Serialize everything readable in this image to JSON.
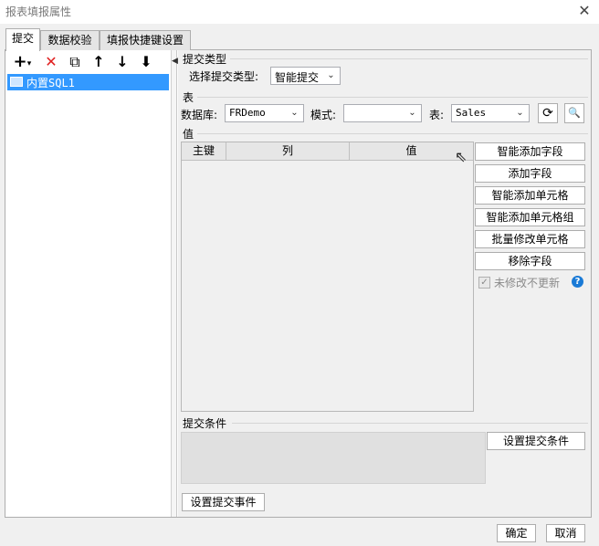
{
  "window": {
    "title": "报表填报属性",
    "close": "✕"
  },
  "tabs": [
    "提交",
    "数据校验",
    "填报快捷键设置"
  ],
  "left_toolbar": {
    "add": "+",
    "add_arrow": "▾",
    "delete": "✕",
    "copy": "⧉",
    "up": "↑",
    "down": "↓",
    "sort": "⬇"
  },
  "tree": {
    "items": [
      {
        "label": "内置SQL1"
      }
    ]
  },
  "splitter_arrow": "◀",
  "submit_type": {
    "section": "提交类型",
    "label": "选择提交类型:",
    "value": "智能提交"
  },
  "table_section": {
    "section": "表",
    "db_label": "数据库:",
    "db_value": "FRDemo",
    "mode_label": "模式:",
    "mode_value": "",
    "table_label": "表:",
    "table_value": "Sales",
    "refresh_icon": "⟳",
    "preview_icon": "🔍"
  },
  "value_section": {
    "section": "值",
    "columns": [
      "主键",
      "列",
      "值"
    ]
  },
  "side_buttons": [
    "智能添加字段",
    "添加字段",
    "智能添加单元格",
    "智能添加单元格组",
    "批量修改单元格",
    "移除字段"
  ],
  "unmodified_no_update": {
    "label": "未修改不更新",
    "checked": true,
    "help": "?"
  },
  "submit_condition": {
    "section": "提交条件",
    "button": "设置提交条件"
  },
  "submit_event_button": "设置提交事件",
  "footer": {
    "ok": "确定",
    "cancel": "取消"
  },
  "colors": {
    "selection": "#3399ff",
    "delete_icon": "#e02020",
    "help": "#1a7ad6"
  }
}
